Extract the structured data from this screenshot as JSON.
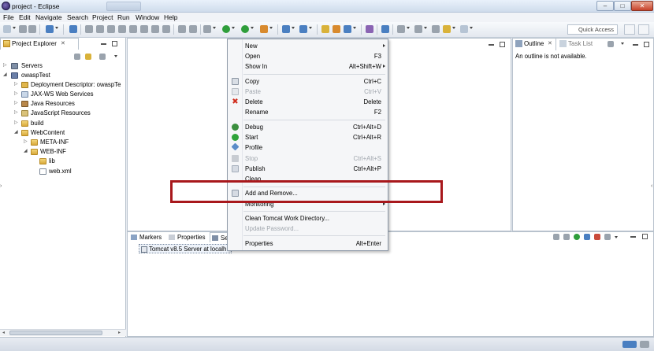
{
  "window": {
    "title": "project - Eclipse",
    "controls": {
      "minimize": "–",
      "maximize": "□",
      "close": "✕"
    }
  },
  "menubar": [
    "File",
    "Edit",
    "Navigate",
    "Search",
    "Project",
    "Run",
    "Window",
    "Help"
  ],
  "toolbar": {
    "quick_access_placeholder": "Quick Access"
  },
  "project_explorer": {
    "tab_label": "Project Explorer",
    "tree": [
      {
        "label": "Servers",
        "level": 0,
        "expanded": false,
        "icon": "server-folder-icon"
      },
      {
        "label": "owaspTest",
        "level": 0,
        "expanded": true,
        "icon": "project-icon"
      },
      {
        "label": "Deployment Descriptor: owaspTe",
        "level": 1,
        "expanded": false,
        "icon": "deployment-descriptor-icon"
      },
      {
        "label": "JAX-WS Web Services",
        "level": 1,
        "expanded": false,
        "icon": "web-services-icon"
      },
      {
        "label": "Java Resources",
        "level": 1,
        "expanded": false,
        "icon": "java-resources-icon"
      },
      {
        "label": "JavaScript Resources",
        "level": 1,
        "expanded": false,
        "icon": "javascript-resources-icon"
      },
      {
        "label": "build",
        "level": 1,
        "expanded": false,
        "icon": "folder-icon"
      },
      {
        "label": "WebContent",
        "level": 1,
        "expanded": true,
        "icon": "folder-icon"
      },
      {
        "label": "META-INF",
        "level": 2,
        "expanded": false,
        "icon": "folder-icon"
      },
      {
        "label": "WEB-INF",
        "level": 2,
        "expanded": true,
        "icon": "folder-icon"
      },
      {
        "label": "lib",
        "level": 3,
        "expanded": null,
        "icon": "folder-icon"
      },
      {
        "label": "web.xml",
        "level": 3,
        "expanded": null,
        "icon": "xml-file-icon"
      }
    ]
  },
  "outline": {
    "tab_label": "Outline",
    "second_tab_label": "Task List",
    "message": "An outline is not available."
  },
  "bottom_panel": {
    "tabs": [
      "Markers",
      "Properties",
      "Ser"
    ],
    "server_entry": "Tomcat v8.5 Server at localh"
  },
  "context_menu": {
    "items": [
      {
        "label": "New",
        "shortcut": "",
        "submenu": true,
        "disabled": false,
        "icon": ""
      },
      {
        "label": "Open",
        "shortcut": "F3",
        "submenu": false,
        "disabled": false,
        "icon": ""
      },
      {
        "label": "Show In",
        "shortcut": "Alt+Shift+W",
        "submenu": true,
        "disabled": false,
        "icon": ""
      },
      {
        "label": "Copy",
        "shortcut": "Ctrl+C",
        "submenu": false,
        "disabled": false,
        "icon": "copy-icon"
      },
      {
        "label": "Paste",
        "shortcut": "Ctrl+V",
        "submenu": false,
        "disabled": true,
        "icon": "paste-icon"
      },
      {
        "label": "Delete",
        "shortcut": "Delete",
        "submenu": false,
        "disabled": false,
        "icon": "delete-icon"
      },
      {
        "label": "Rename",
        "shortcut": "F2",
        "submenu": false,
        "disabled": false,
        "icon": ""
      },
      {
        "label": "Debug",
        "shortcut": "Ctrl+Alt+D",
        "submenu": false,
        "disabled": false,
        "icon": "debug-icon"
      },
      {
        "label": "Start",
        "shortcut": "Ctrl+Alt+R",
        "submenu": false,
        "disabled": false,
        "icon": "start-icon"
      },
      {
        "label": "Profile",
        "shortcut": "",
        "submenu": false,
        "disabled": false,
        "icon": "profile-icon"
      },
      {
        "label": "Stop",
        "shortcut": "Ctrl+Alt+S",
        "submenu": false,
        "disabled": true,
        "icon": "stop-icon"
      },
      {
        "label": "Publish",
        "shortcut": "Ctrl+Alt+P",
        "submenu": false,
        "disabled": false,
        "icon": "publish-icon"
      },
      {
        "label": "Clean...",
        "shortcut": "",
        "submenu": false,
        "disabled": false,
        "icon": ""
      },
      {
        "label": "Add and Remove...",
        "shortcut": "",
        "submenu": false,
        "disabled": false,
        "icon": "add-remove-icon"
      },
      {
        "label": "Monitoring",
        "shortcut": "",
        "submenu": true,
        "disabled": false,
        "icon": ""
      },
      {
        "label": "Clean Tomcat Work Directory...",
        "shortcut": "",
        "submenu": false,
        "disabled": false,
        "icon": ""
      },
      {
        "label": "Update Password...",
        "shortcut": "",
        "submenu": false,
        "disabled": true,
        "icon": ""
      },
      {
        "label": "Properties",
        "shortcut": "Alt+Enter",
        "submenu": false,
        "disabled": false,
        "icon": ""
      }
    ]
  },
  "colors": {
    "highlight_box": "#a8181c",
    "close_button": "#c7422a"
  }
}
